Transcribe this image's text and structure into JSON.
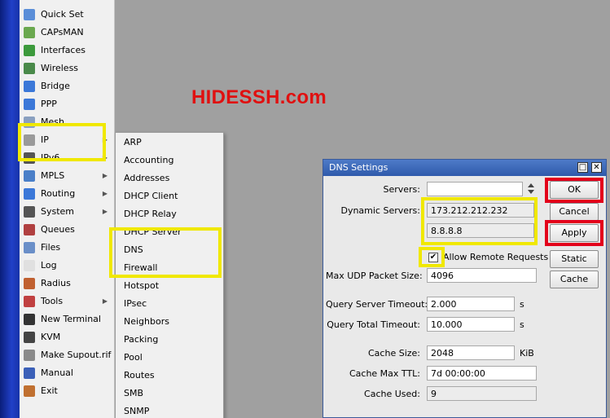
{
  "watermark": "HIDESSH.com",
  "sidebar": {
    "items": [
      {
        "label": "Quick Set",
        "icon": "quick-set-icon",
        "color": "#5a8ed8"
      },
      {
        "label": "CAPsMAN",
        "icon": "capsman-icon",
        "color": "#6aa84f"
      },
      {
        "label": "Interfaces",
        "icon": "interfaces-icon",
        "color": "#3c9a3c"
      },
      {
        "label": "Wireless",
        "icon": "wireless-icon",
        "color": "#4a8a4a"
      },
      {
        "label": "Bridge",
        "icon": "bridge-icon",
        "color": "#3b78d8"
      },
      {
        "label": "PPP",
        "icon": "ppp-icon",
        "color": "#3b78d8"
      },
      {
        "label": "Mesh",
        "icon": "mesh-icon",
        "color": "#8aa0c0"
      },
      {
        "label": "IP",
        "icon": "ip-icon",
        "color": "#9a9a9a",
        "arrow": "▶"
      },
      {
        "label": "IPv6",
        "icon": "ipv6-icon",
        "color": "#555555",
        "arrow": "▶"
      },
      {
        "label": "MPLS",
        "icon": "mpls-icon",
        "color": "#4a7fc8",
        "arrow": "▶"
      },
      {
        "label": "Routing",
        "icon": "routing-icon",
        "color": "#3b78d8",
        "arrow": "▶"
      },
      {
        "label": "System",
        "icon": "system-icon",
        "color": "#555555",
        "arrow": "▶"
      },
      {
        "label": "Queues",
        "icon": "queues-icon",
        "color": "#b04040"
      },
      {
        "label": "Files",
        "icon": "files-icon",
        "color": "#6a8fc8"
      },
      {
        "label": "Log",
        "icon": "log-icon",
        "color": "#e0e0e0"
      },
      {
        "label": "Radius",
        "icon": "radius-icon",
        "color": "#c06030"
      },
      {
        "label": "Tools",
        "icon": "tools-icon",
        "color": "#c04040",
        "arrow": "▶"
      },
      {
        "label": "New Terminal",
        "icon": "terminal-icon",
        "color": "#333333"
      },
      {
        "label": "KVM",
        "icon": "kvm-icon",
        "color": "#444444"
      },
      {
        "label": "Make Supout.rif",
        "icon": "supout-icon",
        "color": "#8a8a8a"
      },
      {
        "label": "Manual",
        "icon": "manual-icon",
        "color": "#3b60b8"
      },
      {
        "label": "Exit",
        "icon": "exit-icon",
        "color": "#c07030"
      }
    ]
  },
  "ip_submenu": {
    "items": [
      "ARP",
      "Accounting",
      "Addresses",
      "DHCP Client",
      "DHCP Relay",
      "DHCP Server",
      "DNS",
      "Firewall",
      "Hotspot",
      "IPsec",
      "Neighbors",
      "Packing",
      "Pool",
      "Routes",
      "SMB",
      "SNMP"
    ]
  },
  "dns": {
    "title": "DNS Settings",
    "servers_label": "Servers:",
    "servers_value": "",
    "dynamic_label": "Dynamic Servers:",
    "dynamic_values": [
      "173.212.212.232",
      "8.8.8.8"
    ],
    "allow_remote_label": "Allow Remote Requests",
    "allow_remote_checked": "✔",
    "max_udp_label": "Max UDP Packet Size:",
    "max_udp_value": "4096",
    "query_server_label": "Query Server Timeout:",
    "query_server_value": "2.000",
    "query_total_label": "Query Total Timeout:",
    "query_total_value": "10.000",
    "seconds_unit": "s",
    "cache_size_label": "Cache Size:",
    "cache_size_value": "2048",
    "cache_size_unit": "KiB",
    "cache_ttl_label": "Cache Max TTL:",
    "cache_ttl_value": "7d 00:00:00",
    "cache_used_label": "Cache Used:",
    "cache_used_value": "9",
    "buttons": {
      "ok": "OK",
      "cancel": "Cancel",
      "apply": "Apply",
      "static": "Static",
      "cache": "Cache"
    },
    "restore_glyph": "□",
    "close_glyph": "✕"
  },
  "highlight_colors": {
    "yellow": "#f0e800",
    "red": "#e3001b"
  }
}
